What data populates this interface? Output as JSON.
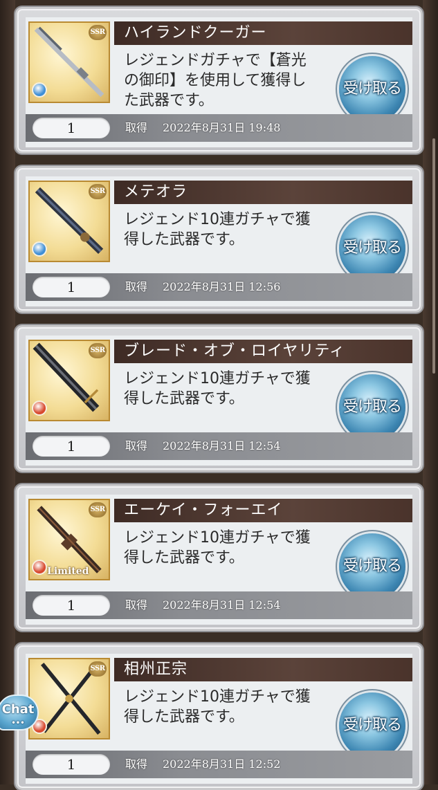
{
  "items": [
    {
      "name": "ハイランドクーガー",
      "desc_lines": [
        "レジェンドガチャで【蒼光",
        "の御印】を使用して獲得し",
        "た武器です。"
      ],
      "quantity": "1",
      "acquired_label": "取得",
      "acquired_date": "2022年8月31日 19:48",
      "rarity": "SSR",
      "element": "water",
      "element_color": "#3f8fd6",
      "weapon": "rifle",
      "limited": "",
      "button_label": "受け取る"
    },
    {
      "name": "メテオラ",
      "desc_lines": [
        "レジェンド10連ガチャで獲",
        "得した武器です。"
      ],
      "quantity": "1",
      "acquired_label": "取得",
      "acquired_date": "2022年8月31日 12:56",
      "rarity": "SSR",
      "element": "water",
      "element_color": "#3f8fd6",
      "weapon": "gun",
      "limited": "",
      "button_label": "受け取る"
    },
    {
      "name": "ブレード・オブ・ロイヤリティ",
      "desc_lines": [
        "レジェンド10連ガチャで獲",
        "得した武器です。"
      ],
      "quantity": "1",
      "acquired_label": "取得",
      "acquired_date": "2022年8月31日 12:54",
      "rarity": "SSR",
      "element": "fire",
      "element_color": "#d8492f",
      "weapon": "sword",
      "limited": "",
      "button_label": "受け取る"
    },
    {
      "name": "エーケイ・フォーエイ",
      "desc_lines": [
        "レジェンド10連ガチャで獲",
        "得した武器です。"
      ],
      "quantity": "1",
      "acquired_label": "取得",
      "acquired_date": "2022年8月31日 12:54",
      "rarity": "SSR",
      "element": "fire",
      "element_color": "#d8492f",
      "weapon": "assault-rifle",
      "limited": "Limited",
      "button_label": "受け取る"
    },
    {
      "name": "相州正宗",
      "desc_lines": [
        "レジェンド10連ガチャで獲",
        "得した武器です。"
      ],
      "quantity": "1",
      "acquired_label": "取得",
      "acquired_date": "2022年8月31日 12:52",
      "rarity": "SSR",
      "element": "fire",
      "element_color": "#d8492f",
      "weapon": "katana",
      "limited": "",
      "button_label": "受け取る"
    }
  ],
  "chat": {
    "label": "Chat",
    "dots": "•••"
  }
}
